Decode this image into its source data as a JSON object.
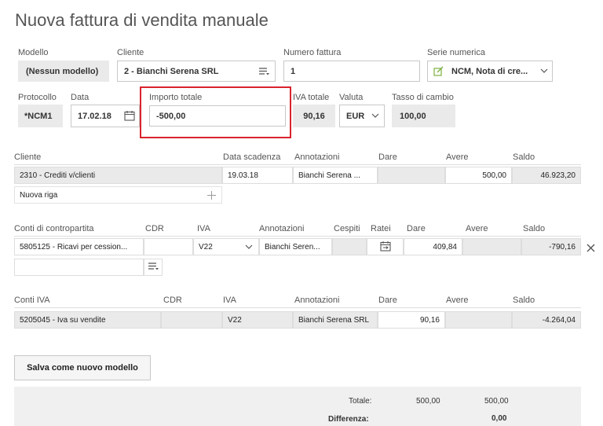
{
  "page": {
    "title": "Nuova fattura di vendita manuale"
  },
  "header": {
    "modello": {
      "label": "Modello",
      "value": "(Nessun modello)"
    },
    "cliente": {
      "label": "Cliente",
      "value": "2 - Bianchi Serena SRL"
    },
    "numero_fattura": {
      "label": "Numero fattura",
      "value": "1"
    },
    "serie_numerica": {
      "label": "Serie numerica",
      "value": "NCM, Nota di cre..."
    },
    "protocollo": {
      "label": "Protocollo",
      "value": "*NCM1"
    },
    "data": {
      "label": "Data",
      "value": "17.02.18"
    },
    "importo_totale": {
      "label": "Importo totale",
      "value": "-500,00"
    },
    "iva_totale": {
      "label": "IVA totale",
      "value": "90,16"
    },
    "valuta": {
      "label": "Valuta",
      "value": "EUR"
    },
    "tasso_cambio": {
      "label": "Tasso di cambio",
      "value": "100,00"
    }
  },
  "cliente_section": {
    "headers": [
      "Cliente",
      "Data scadenza",
      "Annotazioni",
      "Dare",
      "Avere",
      "Saldo"
    ],
    "row": {
      "conto": "2310 - Crediti v/clienti",
      "scadenza": "19.03.18",
      "annotazioni": "Bianchi Serena ...",
      "dare": "",
      "avere": "500,00",
      "saldo": "46.923,20"
    },
    "new_row_label": "Nuova riga"
  },
  "contropartita": {
    "headers": [
      "Conti di contropartita",
      "CDR",
      "IVA",
      "Annotazioni",
      "Cespiti",
      "Ratei",
      "Dare",
      "Avere",
      "Saldo"
    ],
    "row": {
      "conto": "5805125 - Ricavi per cession...",
      "cdr": "",
      "iva": "V22",
      "annotazioni": "Bianchi Seren...",
      "dare": "409,84",
      "avere": "",
      "saldo": "-790,16"
    }
  },
  "conti_iva": {
    "headers": [
      "Conti IVA",
      "CDR",
      "IVA",
      "Annotazioni",
      "Dare",
      "Avere",
      "Saldo"
    ],
    "row": {
      "conto": "5205045 - Iva su vendite",
      "cdr": "",
      "iva": "V22",
      "annotazioni": "Bianchi Serena SRL",
      "dare": "90,16",
      "avere": "",
      "saldo": "-4.264,04"
    }
  },
  "buttons": {
    "salva_modello": "Salva come nuovo modello"
  },
  "totals": {
    "totale_label": "Totale:",
    "totale_dare": "500,00",
    "totale_avere": "500,00",
    "differenza_label": "Differenza:",
    "differenza_value": "0,00"
  },
  "colors": {
    "highlight": "#d9232d",
    "readonly_bg": "#eaeaea"
  }
}
